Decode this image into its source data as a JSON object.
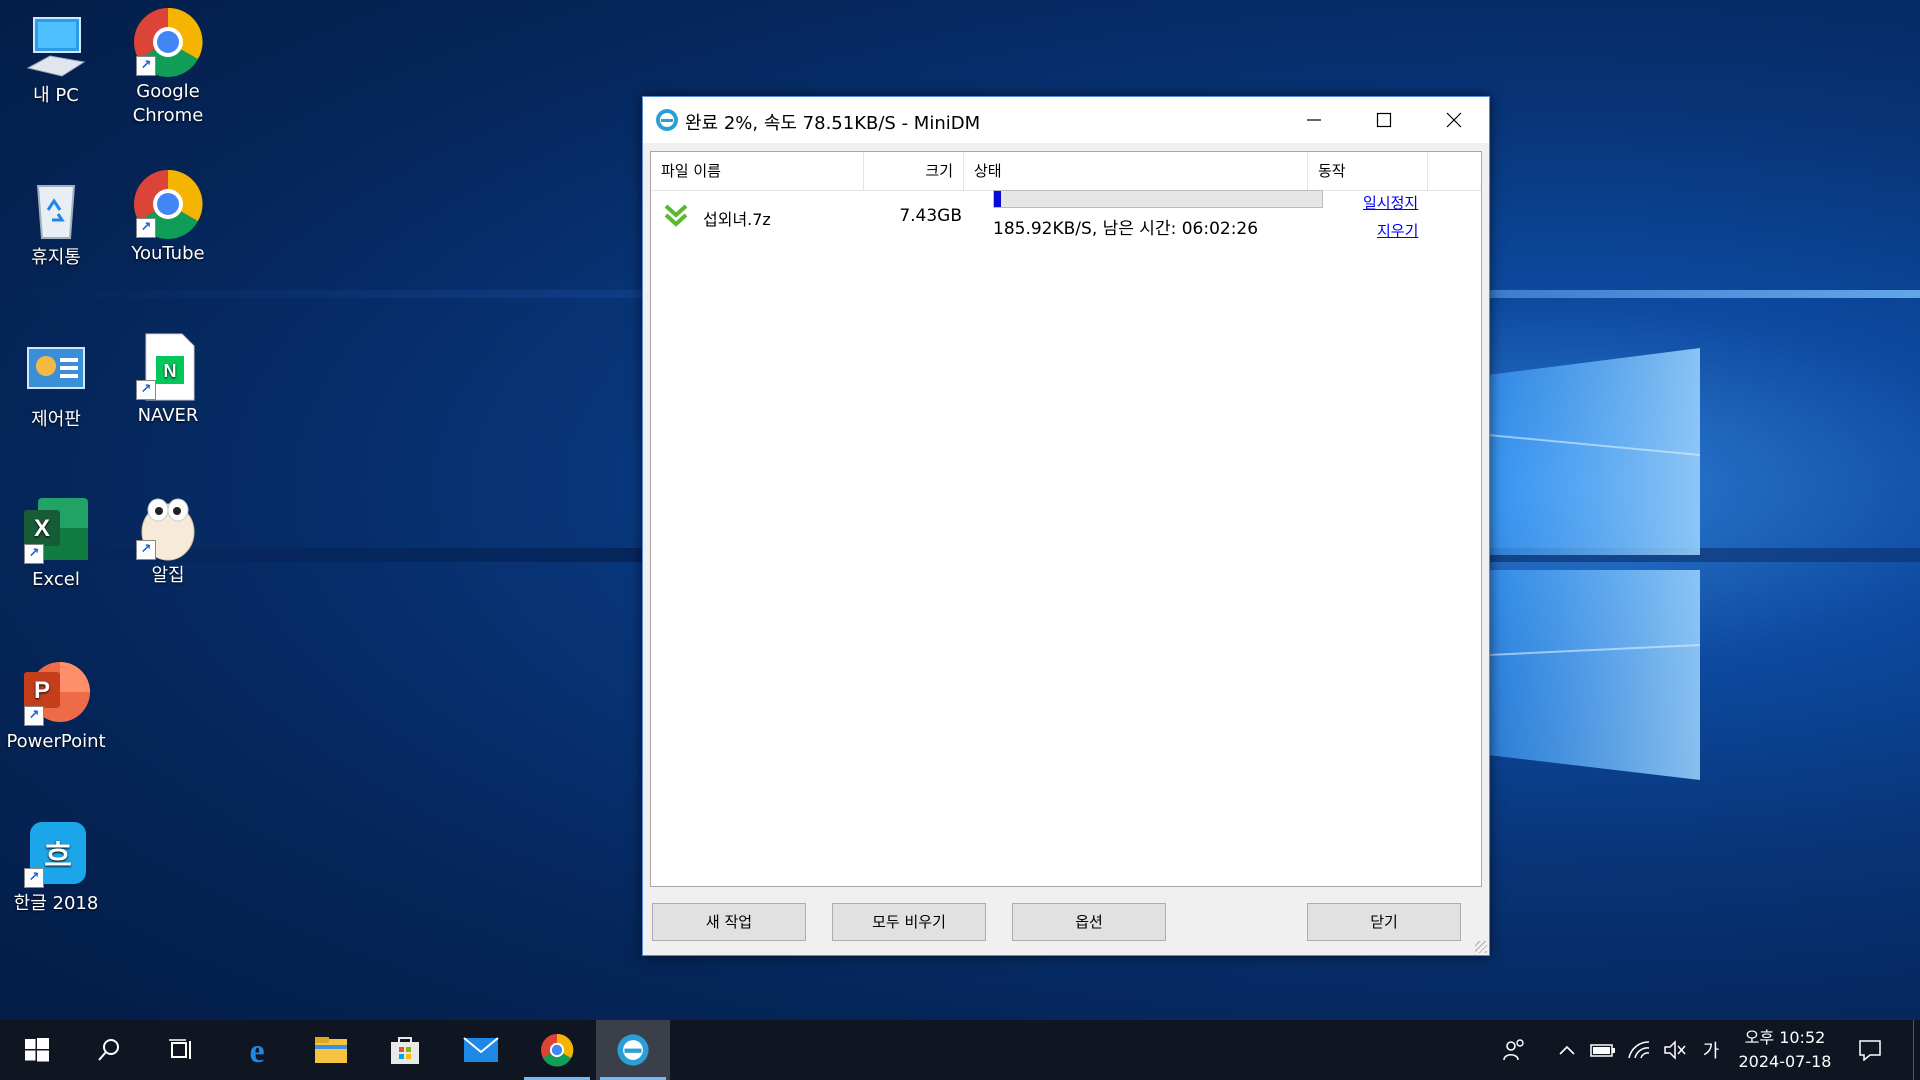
{
  "desktop": {
    "icons": [
      {
        "label": "내 PC"
      },
      {
        "label": "Google Chrome"
      },
      {
        "label": "휴지통"
      },
      {
        "label": "YouTube"
      },
      {
        "label": "제어판"
      },
      {
        "label": "NAVER"
      },
      {
        "label": "Excel"
      },
      {
        "label": "알집"
      },
      {
        "label": "PowerPoint"
      },
      {
        "label": "한글 2018"
      }
    ]
  },
  "window": {
    "title": "완료 2%, 속도 78.51KB/S - MiniDM",
    "columns": [
      "파일 이름",
      "크기",
      "상태",
      "동작"
    ],
    "rows": [
      {
        "filename": "섭외녀.7z",
        "size": "7.43GB",
        "progress_percent": 2,
        "status_text": "185.92KB/S, 남은 시간: 06:02:26",
        "action_pause": "일시정지",
        "action_delete": "지우기"
      }
    ],
    "buttons": {
      "new_task": "새 작업",
      "clear_all": "모두 비우기",
      "options": "옵션",
      "close": "닫기"
    }
  },
  "taskbar": {
    "apps": [
      "start",
      "search",
      "task-view",
      "edge",
      "file-explorer",
      "store",
      "mail",
      "chrome",
      "minidm"
    ],
    "ime": "가",
    "clock": {
      "time": "오후 10:52",
      "date": "2024-07-18"
    }
  },
  "colors": {
    "accent": "#0078d7",
    "progress": "#0a0ad8",
    "link": "#0000ee"
  }
}
